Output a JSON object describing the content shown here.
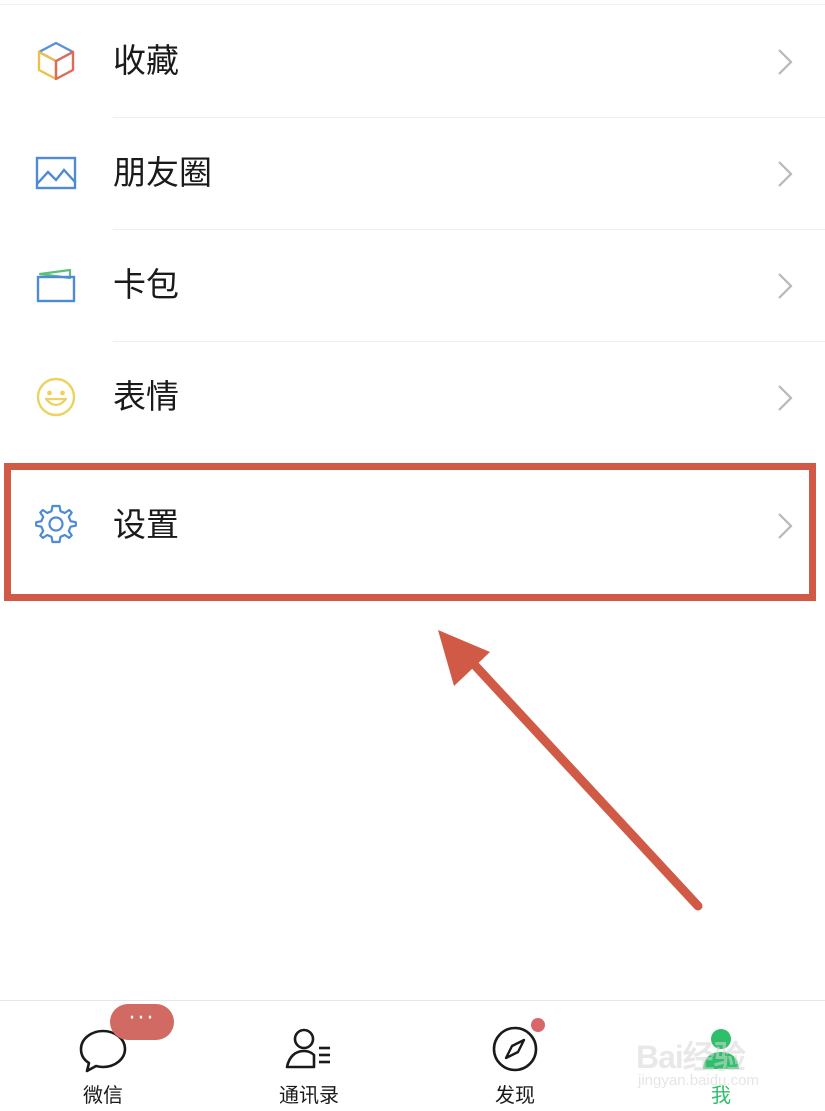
{
  "menu": {
    "items": [
      {
        "label": "收藏",
        "icon": "favorites-cube-icon"
      },
      {
        "label": "朋友圈",
        "icon": "moments-image-icon"
      },
      {
        "label": "卡包",
        "icon": "card-wallet-icon"
      },
      {
        "label": "表情",
        "icon": "sticker-smiley-icon"
      },
      {
        "label": "设置",
        "icon": "settings-gear-icon"
      }
    ]
  },
  "annotation": {
    "highlight_color": "#d05a45",
    "highlighted_item": "设置"
  },
  "tabbar": {
    "tabs": [
      {
        "label": "微信",
        "icon": "chat-bubble-icon",
        "badge": "···"
      },
      {
        "label": "通讯录",
        "icon": "contacts-icon"
      },
      {
        "label": "发现",
        "icon": "discover-compass-icon"
      },
      {
        "label": "我",
        "icon": "me-person-icon"
      }
    ],
    "active_color": "#2fbf6a"
  },
  "watermark": {
    "brand": "Bai经验",
    "url": "jingyan.baidu.com"
  }
}
